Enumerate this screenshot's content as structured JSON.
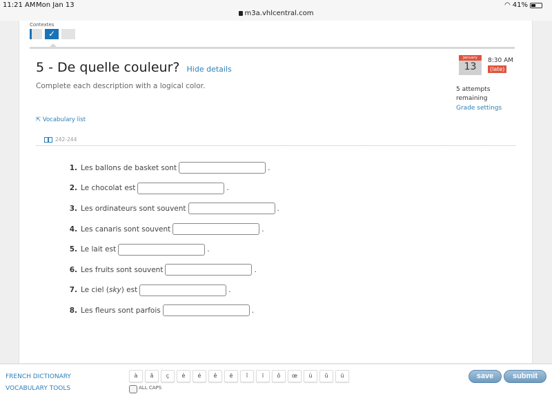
{
  "status_bar": {
    "time": "11:21 AM",
    "date": "Mon Jan 13",
    "battery": "41%",
    "battery_level": 0.41,
    "url": "m3a.vhlcentral.com"
  },
  "context": {
    "label": "Contextes",
    "tabs": [
      {
        "state": "partial"
      },
      {
        "state": "active",
        "icon": "check-icon",
        "glyph": "✓"
      },
      {
        "state": "empty"
      }
    ]
  },
  "activity": {
    "title": "5 - De quelle couleur?",
    "hide_details": "Hide details",
    "instructions": "Complete each description with a logical color.",
    "vocab_link": "⇱ Vocabulary list",
    "page_ref": "242-244"
  },
  "due": {
    "month": "January",
    "day": "13",
    "time": "8:30 AM",
    "status": "(late)",
    "attempts": "5 attempts remaining",
    "grade_settings": "Grade settings"
  },
  "questions": [
    {
      "num": "1.",
      "prompt": "Les ballons de basket sont",
      "value": ""
    },
    {
      "num": "2.",
      "prompt": "Le chocolat est",
      "value": ""
    },
    {
      "num": "3.",
      "prompt": "Les ordinateurs sont souvent",
      "value": ""
    },
    {
      "num": "4.",
      "prompt": "Les canaris sont souvent",
      "value": ""
    },
    {
      "num": "5.",
      "prompt": "Le lait est",
      "value": ""
    },
    {
      "num": "6.",
      "prompt": "Les fruits sont souvent",
      "value": ""
    },
    {
      "num": "7.",
      "prompt_pre": "Le ciel (",
      "prompt_italic": "sky",
      "prompt_post": ") est",
      "value": ""
    },
    {
      "num": "8.",
      "prompt": "Les fleurs sont parfois",
      "value": ""
    }
  ],
  "period": ".",
  "footer": {
    "french_dictionary": "FRENCH DICTIONARY",
    "vocabulary_tools": "VOCABULARY TOOLS",
    "accent_chars": [
      "à",
      "â",
      "ç",
      "è",
      "é",
      "ê",
      "ë",
      "î",
      "ï",
      "ô",
      "œ",
      "ù",
      "û",
      "ü"
    ],
    "all_caps": "ALL CAPS",
    "save": "save",
    "submit": "submit"
  }
}
